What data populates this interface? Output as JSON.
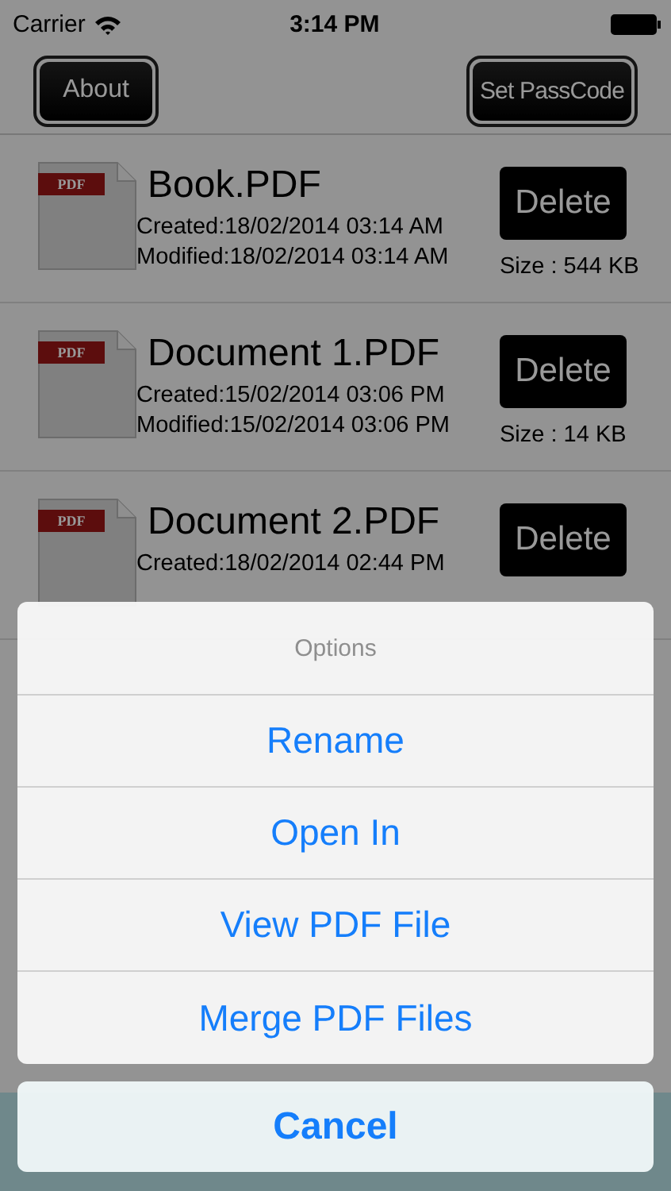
{
  "status_bar": {
    "carrier": "Carrier",
    "time": "3:14 PM"
  },
  "nav": {
    "left_button": "About",
    "right_button": "Set PassCode"
  },
  "files": [
    {
      "icon_text": "PDF",
      "name": "Book.PDF",
      "created": "Created:18/02/2014 03:14 AM",
      "modified": "Modified:18/02/2014 03:14 AM",
      "size": "Size : 544 KB",
      "delete": "Delete"
    },
    {
      "icon_text": "PDF",
      "name": "Document 1.PDF",
      "created": "Created:15/02/2014 03:06 PM",
      "modified": "Modified:15/02/2014 03:06 PM",
      "size": "Size : 14 KB",
      "delete": "Delete"
    },
    {
      "icon_text": "PDF",
      "name": "Document 2.PDF",
      "created": "Created:18/02/2014 02:44 PM",
      "delete": "Delete"
    }
  ],
  "action_sheet": {
    "title": "Options",
    "options": [
      "Rename",
      "Open In",
      "View PDF File",
      "Merge PDF Files"
    ],
    "cancel": "Cancel"
  }
}
